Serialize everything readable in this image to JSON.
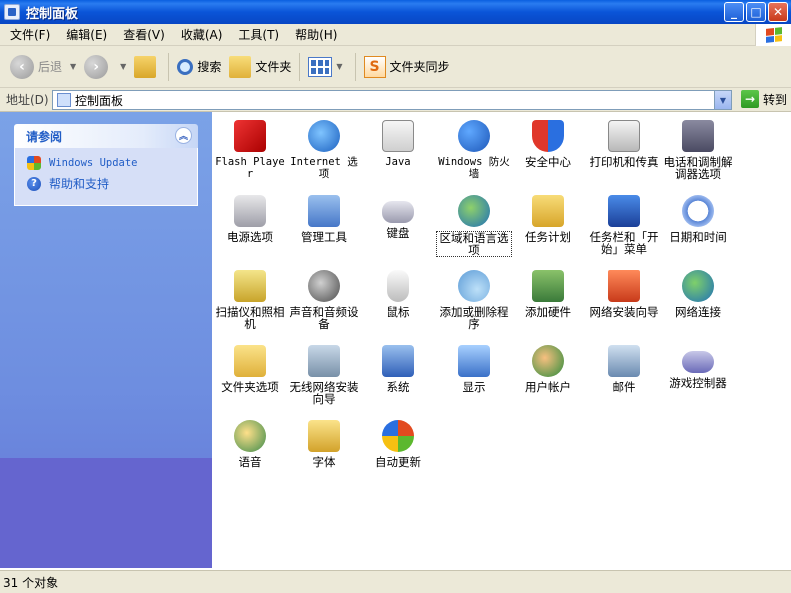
{
  "window": {
    "title": "控制面板",
    "buttons": {
      "minimize": "_",
      "maximize": "□",
      "close": "✕"
    }
  },
  "menu": {
    "items": [
      "文件(F)",
      "编辑(E)",
      "查看(V)",
      "收藏(A)",
      "工具(T)",
      "帮助(H)"
    ]
  },
  "toolbar": {
    "back_label": "后退",
    "search_label": "搜索",
    "folders_label": "文件夹",
    "sync_label": "文件夹同步"
  },
  "address": {
    "label": "地址(D)",
    "value": "控制面板",
    "go_label": "转到"
  },
  "sidebar": {
    "section_title": "请参阅",
    "links": [
      {
        "label": "Windows Update",
        "icon": "windows-update-icon"
      },
      {
        "label": "帮助和支持",
        "icon": "help-icon"
      }
    ]
  },
  "items": [
    {
      "label": "Flash Player",
      "icon": "flash-player-icon"
    },
    {
      "label": "Internet 选项",
      "icon": "internet-options-icon"
    },
    {
      "label": "Java",
      "icon": "java-icon"
    },
    {
      "label": "Windows 防火墙",
      "icon": "firewall-icon"
    },
    {
      "label": "安全中心",
      "icon": "security-center-icon"
    },
    {
      "label": "打印机和传真",
      "icon": "printer-icon"
    },
    {
      "label": "电话和调制解调器选项",
      "icon": "phone-modem-icon"
    },
    {
      "label": "电源选项",
      "icon": "power-icon"
    },
    {
      "label": "管理工具",
      "icon": "admin-tools-icon"
    },
    {
      "label": "键盘",
      "icon": "keyboard-icon"
    },
    {
      "label": "区域和语言选项",
      "icon": "region-language-icon"
    },
    {
      "label": "任务计划",
      "icon": "scheduled-tasks-icon"
    },
    {
      "label": "任务栏和「开始」菜单",
      "icon": "taskbar-start-icon"
    },
    {
      "label": "日期和时间",
      "icon": "date-time-icon"
    },
    {
      "label": "扫描仪和照相机",
      "icon": "scanner-camera-icon"
    },
    {
      "label": "声音和音频设备",
      "icon": "sound-audio-icon"
    },
    {
      "label": "鼠标",
      "icon": "mouse-icon"
    },
    {
      "label": "添加或删除程序",
      "icon": "add-remove-programs-icon"
    },
    {
      "label": "添加硬件",
      "icon": "add-hardware-icon"
    },
    {
      "label": "网络安装向导",
      "icon": "network-setup-icon"
    },
    {
      "label": "网络连接",
      "icon": "network-connections-icon"
    },
    {
      "label": "文件夹选项",
      "icon": "folder-options-icon"
    },
    {
      "label": "无线网络安装向导",
      "icon": "wireless-setup-icon"
    },
    {
      "label": "系统",
      "icon": "system-icon"
    },
    {
      "label": "显示",
      "icon": "display-icon"
    },
    {
      "label": "用户帐户",
      "icon": "user-accounts-icon"
    },
    {
      "label": "邮件",
      "icon": "mail-icon"
    },
    {
      "label": "游戏控制器",
      "icon": "game-controller-icon"
    },
    {
      "label": "语音",
      "icon": "speech-icon"
    },
    {
      "label": "字体",
      "icon": "fonts-icon"
    },
    {
      "label": "自动更新",
      "icon": "automatic-updates-icon"
    }
  ],
  "status": {
    "text": "31 个对象"
  }
}
